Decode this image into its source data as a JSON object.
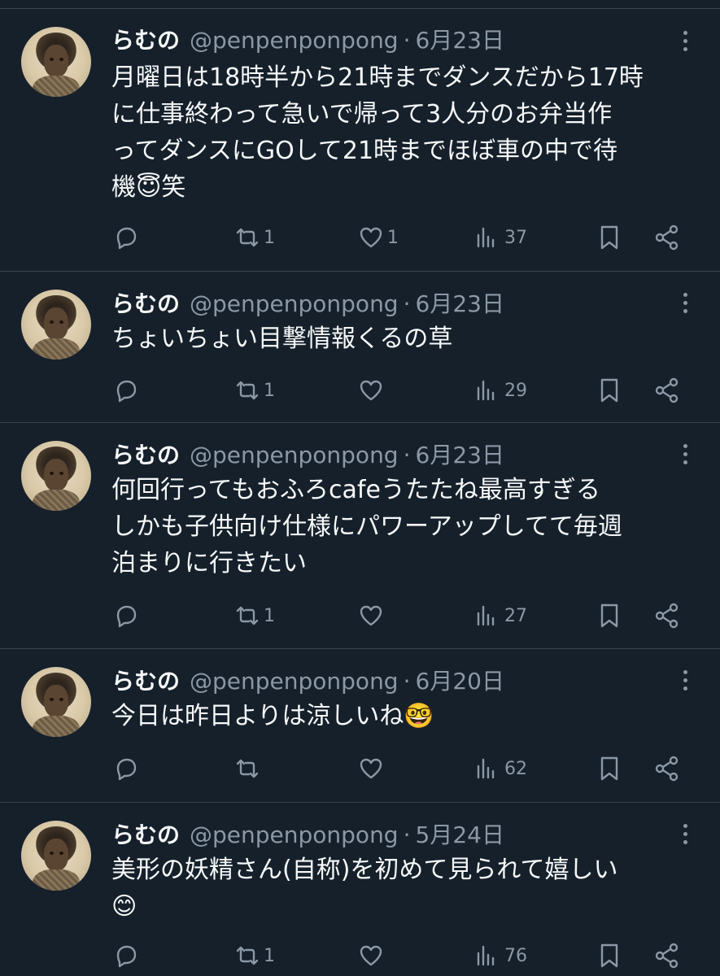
{
  "tweets": [
    {
      "name": "らむの",
      "handle": "@penpenponpong",
      "date": "6月23日",
      "text": "月曜日は18時半から21時までダンスだから17時\nに仕事終わって急いで帰って3人分のお弁当作\nってダンスにGOして21時までほぼ車の中で待\n機😇笑",
      "replies": "",
      "retweets": "1",
      "likes": "1",
      "views": "37"
    },
    {
      "name": "らむの",
      "handle": "@penpenponpong",
      "date": "6月23日",
      "text": "ちょいちょい目撃情報くるの草",
      "replies": "",
      "retweets": "1",
      "likes": "",
      "views": "29"
    },
    {
      "name": "らむの",
      "handle": "@penpenponpong",
      "date": "6月23日",
      "text": "何回行ってもおふろcafeうたたね最高すぎる\nしかも子供向け仕様にパワーアップしてて毎週\n泊まりに行きたい",
      "replies": "",
      "retweets": "1",
      "likes": "",
      "views": "27"
    },
    {
      "name": "らむの",
      "handle": "@penpenponpong",
      "date": "6月20日",
      "text": "今日は昨日よりは涼しいね🤓",
      "replies": "",
      "retweets": "",
      "likes": "",
      "views": "62"
    },
    {
      "name": "らむの",
      "handle": "@penpenponpong",
      "date": "5月24日",
      "text": "美形の妖精さん(自称)を初めて見られて嬉しい\n😊",
      "replies": "",
      "retweets": "1",
      "likes": "",
      "views": "76"
    }
  ],
  "separator": "·",
  "icons": {
    "reply": "reply-icon",
    "retweet": "retweet-icon",
    "like": "heart-icon",
    "views": "views-icon",
    "bookmark": "bookmark-icon",
    "share": "share-icon",
    "more": "more-icon"
  },
  "colors": {
    "background": "#15202b",
    "text": "#f7f9f9",
    "secondary": "#8b98a5",
    "divider": "#38444d"
  }
}
